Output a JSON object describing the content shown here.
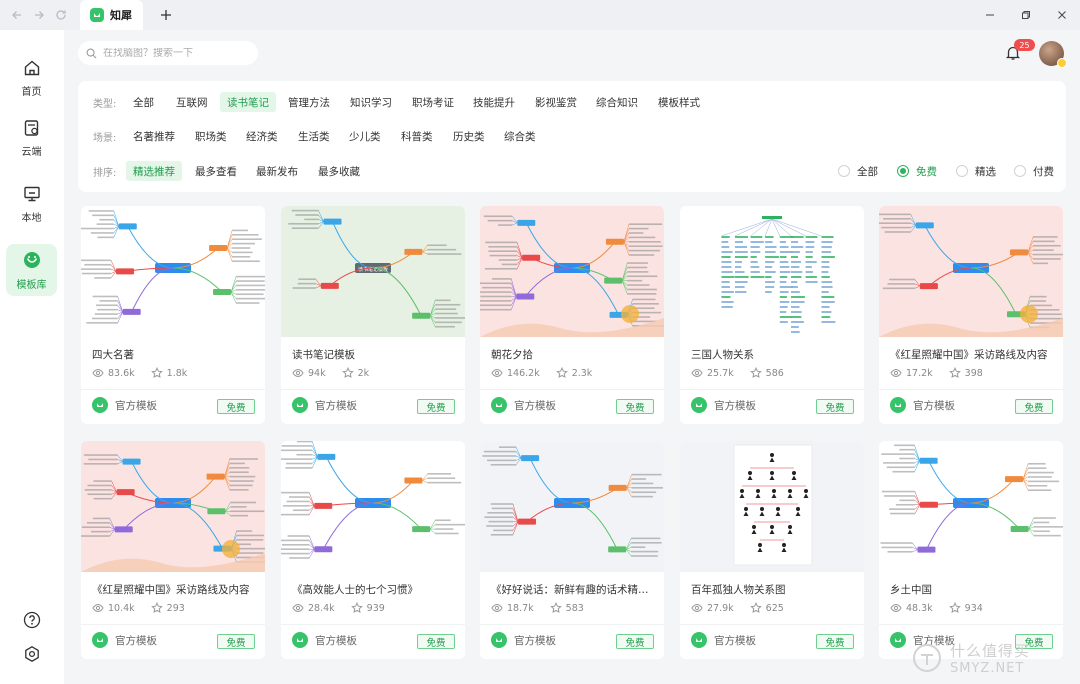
{
  "app": {
    "tab_title": "知犀"
  },
  "sidebar": {
    "items": [
      {
        "label": "首页",
        "icon": "home-icon"
      },
      {
        "label": "云端",
        "icon": "cloud-doc-icon"
      },
      {
        "label": "本地",
        "icon": "monitor-icon"
      },
      {
        "label": "模板库",
        "icon": "template-icon",
        "active": true
      }
    ]
  },
  "search": {
    "placeholder": "在找脑图？搜索一下"
  },
  "notifications": {
    "count": "25"
  },
  "filters": {
    "type_label": "类型:",
    "types": [
      "全部",
      "互联网",
      "读书笔记",
      "管理方法",
      "知识学习",
      "职场考证",
      "技能提升",
      "影视鉴赏",
      "综合知识",
      "模板样式"
    ],
    "type_active": "读书笔记",
    "scene_label": "场景:",
    "scenes": [
      "名著推荐",
      "职场类",
      "经济类",
      "生活类",
      "少儿类",
      "科普类",
      "历史类",
      "综合类"
    ],
    "sort_label": "排序:",
    "sorts": [
      "精选推荐",
      "最多查看",
      "最新发布",
      "最多收藏"
    ],
    "sort_active": "精选推荐",
    "price": [
      "全部",
      "免费",
      "精选",
      "付费"
    ],
    "price_active": "免费"
  },
  "cards": [
    {
      "title": "四大名著",
      "views": "83.6k",
      "stars": "1.8k",
      "thumb": "white",
      "author": "官方模板",
      "tag": "免费"
    },
    {
      "title": "读书笔记模板",
      "views": "94k",
      "stars": "2k",
      "thumb": "green",
      "center_label": "读书笔记模板",
      "author": "官方模板",
      "tag": "免费"
    },
    {
      "title": "朝花夕拾",
      "views": "146.2k",
      "stars": "2.3k",
      "thumb": "pink",
      "author": "官方模板",
      "tag": "免费"
    },
    {
      "title": "三国人物关系",
      "views": "25.7k",
      "stars": "586",
      "thumb": "white",
      "author": "官方模板",
      "tag": "免费"
    },
    {
      "title": "《红星照耀中国》采访路线及内容",
      "views": "17.2k",
      "stars": "398",
      "thumb": "pink",
      "author": "官方模板",
      "tag": "免费"
    },
    {
      "title": "《红星照耀中国》采访路线及内容",
      "views": "10.4k",
      "stars": "293",
      "thumb": "pink",
      "author": "官方模板",
      "tag": "免费"
    },
    {
      "title": "《高效能人士的七个习惯》",
      "views": "28.4k",
      "stars": "939",
      "thumb": "white",
      "author": "官方模板",
      "tag": "免费"
    },
    {
      "title": "《好好说话：新鲜有趣的话术精进技巧》",
      "views": "18.7k",
      "stars": "583",
      "thumb": "gray",
      "author": "官方模板",
      "tag": "免费"
    },
    {
      "title": "百年孤独人物关系图",
      "views": "27.9k",
      "stars": "625",
      "thumb": "gray",
      "author": "官方模板",
      "tag": "免费"
    },
    {
      "title": "乡土中国",
      "views": "48.3k",
      "stars": "934",
      "thumb": "white",
      "author": "官方模板",
      "tag": "免费"
    }
  ],
  "watermark": {
    "text": "什么值得买",
    "site": "SMYZ.NET"
  },
  "colors": {
    "accent": "#2db35d",
    "accent_bg": "#e3f6e8",
    "badge": "#f24d4d"
  }
}
